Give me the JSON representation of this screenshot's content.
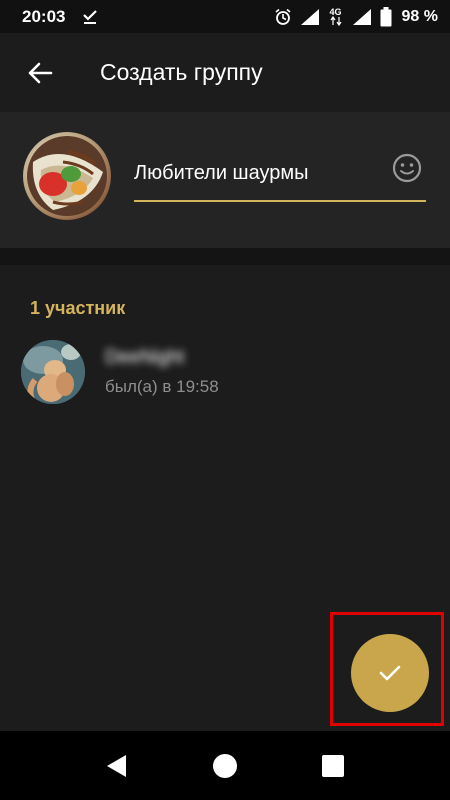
{
  "status_bar": {
    "time": "20:03",
    "network_label": "4G",
    "battery": "98 %"
  },
  "app_bar": {
    "title": "Создать группу",
    "back_icon": "arrow-left-icon"
  },
  "group": {
    "name_value": "Любители шаурмы",
    "emoji_icon": "smiley-icon"
  },
  "members": {
    "header": "1 участник",
    "items": [
      {
        "name": "DeeNight",
        "status": "был(а) в 19:58"
      }
    ]
  },
  "fab": {
    "icon": "check-icon"
  },
  "colors": {
    "accent": "#c9a64b",
    "accent_text": "#d4b45c",
    "highlight": "#e00000",
    "background": "#1c1c1c"
  }
}
